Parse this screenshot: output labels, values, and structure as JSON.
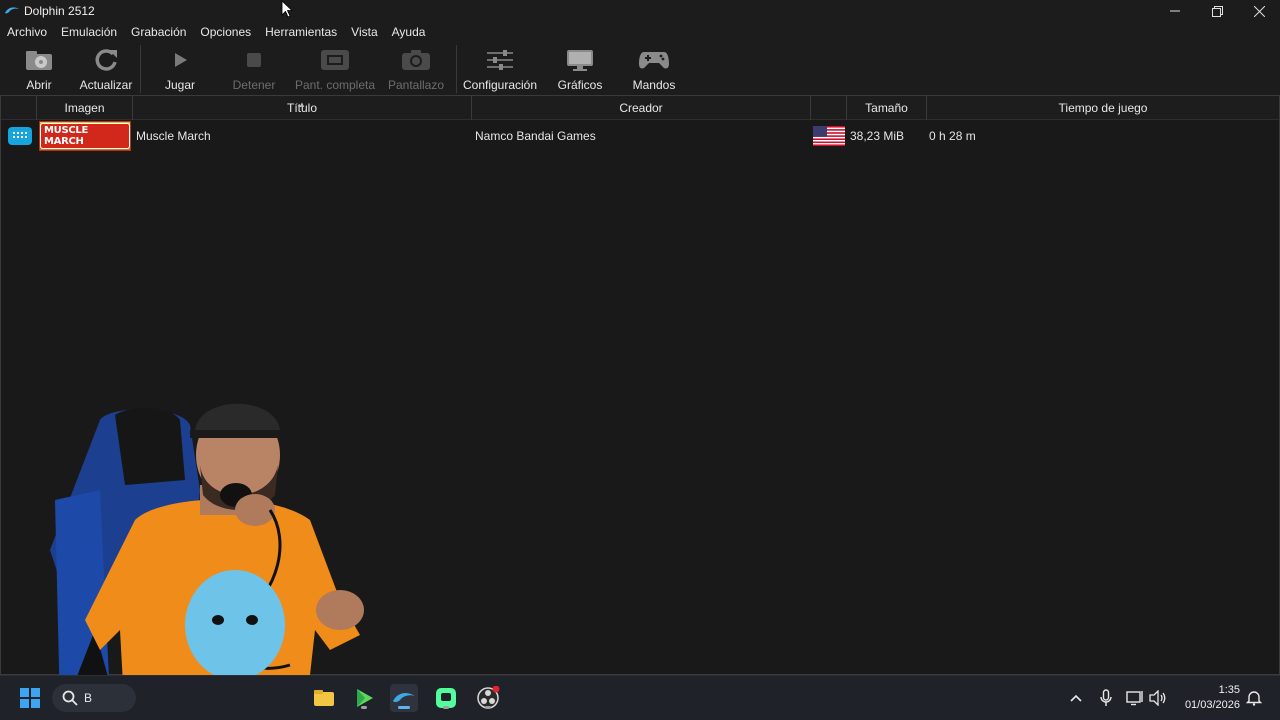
{
  "window": {
    "title": "Dolphin 2512"
  },
  "menu": [
    "Archivo",
    "Emulación",
    "Grabación",
    "Opciones",
    "Herramientas",
    "Vista",
    "Ayuda"
  ],
  "toolbar": {
    "open": "Abrir",
    "refresh": "Actualizar",
    "play": "Jugar",
    "stop": "Detener",
    "fullscreen": "Pant. completa",
    "screenshot": "Pantallazo",
    "config": "Configuración",
    "graphics": "Gráficos",
    "controllers": "Mandos"
  },
  "columns": {
    "image": "Imagen",
    "title": "Título",
    "maker": "Creador",
    "size": "Tamaño",
    "playtime": "Tiempo de juego"
  },
  "games": [
    {
      "platform": "wii-icon",
      "banner_text": "MUSCLE MARCH",
      "title": "Muscle March",
      "maker": "Namco Bandai Games",
      "region": "usa-flag-icon",
      "size": "38,23 MiB",
      "playtime": "0 h 28 m"
    }
  ],
  "taskbar": {
    "search_partial": "B",
    "clock_time": "1:35",
    "clock_date": "01/03/2026"
  },
  "colors": {
    "accent": "#17a5e0",
    "background": "#191919",
    "taskbar": "#1f2229"
  }
}
